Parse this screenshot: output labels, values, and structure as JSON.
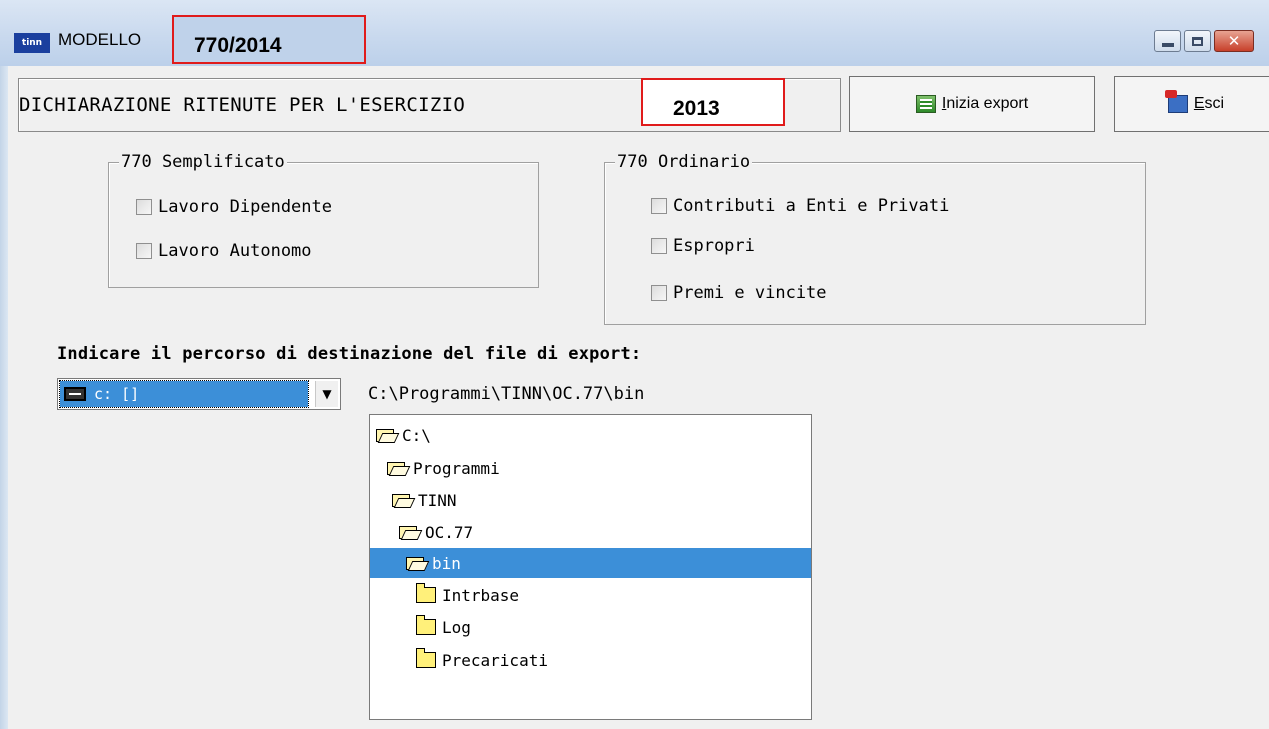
{
  "window": {
    "app_icon_text": "tinn",
    "title": "MODELLO",
    "model_code": "770/2014"
  },
  "toolbar": {
    "declaration_label": "DICHIARAZIONE RITENUTE PER L'ESERCIZIO",
    "year": "2013",
    "export_button_mnemonic": "I",
    "export_button_rest": "nizia export",
    "exit_button_mnemonic": "E",
    "exit_button_rest": "sci"
  },
  "semplificato": {
    "title": "770 Semplificato",
    "items": [
      {
        "label": "Lavoro Dipendente",
        "checked": false
      },
      {
        "label": "Lavoro Autonomo",
        "checked": false
      }
    ]
  },
  "ordinario": {
    "title": "770 Ordinario",
    "items": [
      {
        "label": "Contributi a Enti e Privati",
        "checked": false
      },
      {
        "label": "Espropri",
        "checked": false
      },
      {
        "label": "Premi e vincite",
        "checked": false
      }
    ]
  },
  "destination": {
    "label": "Indicare il percorso di destinazione del file di export:",
    "drive": "c: []",
    "current_path": "C:\\Programmi\\TINN\\OC.77\\bin",
    "folders": [
      {
        "name": "C:\\",
        "type": "open",
        "selected": false
      },
      {
        "name": "Programmi",
        "type": "open",
        "selected": false
      },
      {
        "name": "TINN",
        "type": "open",
        "selected": false
      },
      {
        "name": "OC.77",
        "type": "open",
        "selected": false
      },
      {
        "name": "bin",
        "type": "open",
        "selected": true
      },
      {
        "name": "Intrbase",
        "type": "closed",
        "selected": false
      },
      {
        "name": "Log",
        "type": "closed",
        "selected": false
      },
      {
        "name": "Precaricati",
        "type": "closed",
        "selected": false
      }
    ]
  }
}
